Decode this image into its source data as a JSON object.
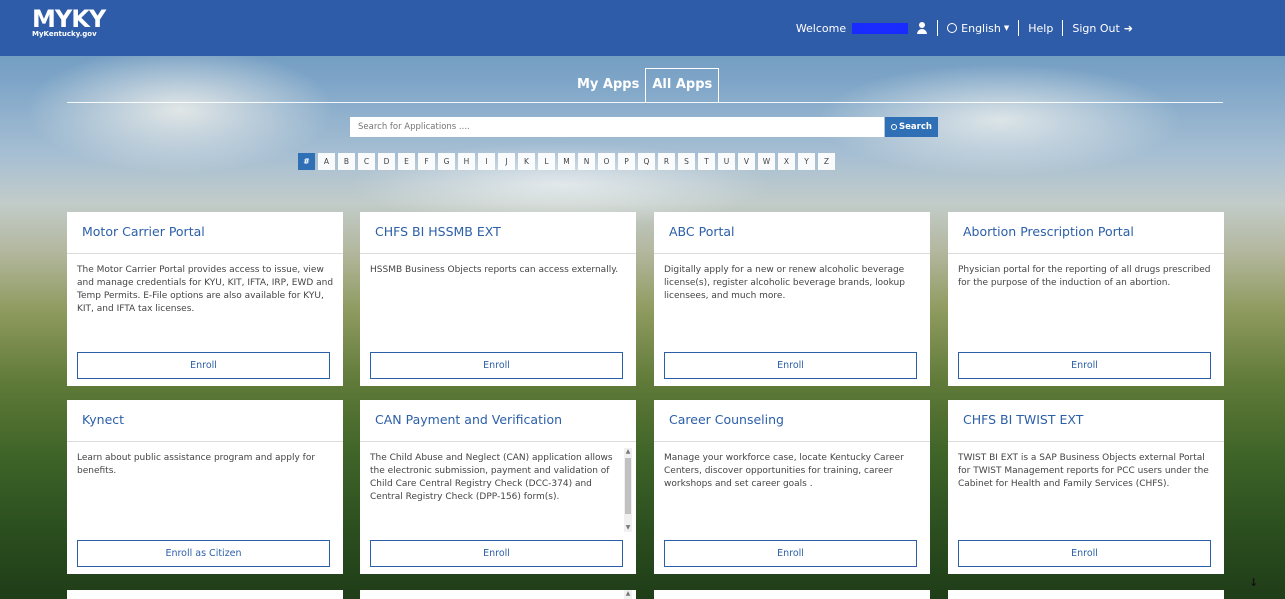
{
  "header": {
    "logo_main": "MYKY",
    "logo_sub": "MyKentucky.gov",
    "welcome": "Welcome",
    "language": "English",
    "help": "Help",
    "signout": "Sign Out"
  },
  "tabs": [
    "My Apps",
    "All Apps"
  ],
  "search": {
    "placeholder": "Search for Applications ....",
    "button": "Search"
  },
  "letters": [
    "#",
    "A",
    "B",
    "C",
    "D",
    "E",
    "F",
    "G",
    "H",
    "I",
    "J",
    "K",
    "L",
    "M",
    "N",
    "O",
    "P",
    "Q",
    "R",
    "S",
    "T",
    "U",
    "V",
    "W",
    "X",
    "Y",
    "Z"
  ],
  "cards": [
    {
      "title": "Motor Carrier Portal",
      "desc": "The Motor Carrier Portal provides access to issue, view and manage credentials for KYU, KIT, IFTA, IRP, EWD and Temp Permits. E-File options are also available for KYU, KIT, and IFTA tax licenses.",
      "button": "Enroll"
    },
    {
      "title": "CHFS BI HSSMB EXT",
      "desc": "HSSMB Business Objects reports can access externally.",
      "button": "Enroll"
    },
    {
      "title": "ABC Portal",
      "desc": "Digitally apply for a new or renew alcoholic beverage license(s), register alcoholic beverage brands, lookup licensees, and much more.",
      "button": "Enroll"
    },
    {
      "title": "Abortion Prescription Portal",
      "desc": "Physician portal for the reporting of all drugs prescribed for the purpose of the induction of an abortion.",
      "button": "Enroll"
    },
    {
      "title": "Kynect",
      "desc": "Learn about public assistance program and apply for benefits.",
      "button": "Enroll as Citizen"
    },
    {
      "title": "CAN Payment and Verification",
      "desc": "The Child Abuse and Neglect (CAN) application allows the electronic submission, payment and validation of Child Care Central Registry Check (DCC-374) and Central Registry Check (DPP-156) form(s).",
      "button": "Enroll"
    },
    {
      "title": "Career Counseling",
      "desc": "Manage your workforce case, locate Kentucky Career Centers, discover opportunities for training, career workshops and set career goals .",
      "button": "Enroll"
    },
    {
      "title": "CHFS BI TWIST EXT",
      "desc": "TWIST BI EXT is a SAP Business Objects external Portal for TWIST Management reports for PCC users under the Cabinet for Health and Family Services (CHFS).",
      "button": "Enroll"
    }
  ],
  "colors": {
    "header_bg": "#2f5ca8",
    "accent": "#2b5fa8",
    "active_letter": "#2f6fb6",
    "redaction": "#1a2bff"
  }
}
